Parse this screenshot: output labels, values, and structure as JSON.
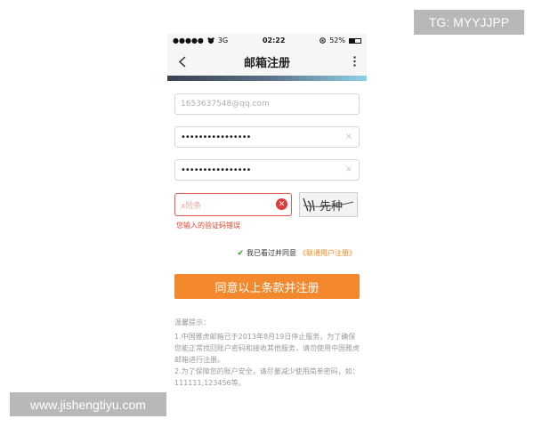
{
  "watermarks": {
    "top_right": "TG: MYYJJPP",
    "bottom_left": "www.jishengtiyu.com"
  },
  "status_bar": {
    "signal": "●●●●●",
    "carrier_icon": "bear-logo-icon",
    "network": "3G",
    "time": "02:22",
    "battery_percent": "52%",
    "battery_level": 0.52
  },
  "nav": {
    "title": "邮箱注册",
    "back_icon": "chevron-left-icon",
    "more_icon": "more-vertical-icon"
  },
  "form": {
    "email_placeholder": "1653637548@qq.com",
    "password_value": "••••••••••••••••",
    "confirm_password_value": "••••••••••••••••",
    "clear_glyph": "×",
    "captcha_placeholder": "x险条",
    "captcha_image_text": "先种",
    "error_icon_glyph": "✕",
    "error_message": "您输入的验证码错误"
  },
  "agreement": {
    "check_glyph": "✔",
    "text": "我已看过并同意",
    "link": "《联通用户注册》"
  },
  "submit_label": "同意以上条款并注册",
  "tips": {
    "title": "温馨提示：",
    "line1": "1.中国雅虎邮箱已于2013年8月19日停止服务，为了确保您能正常找回账户密码和接收其他服务，请勿使用中国雅虎邮箱进行注册。",
    "line2": "2.为了保障您的账户安全，请尽量减少使用简单密码，如：111111,123456等。"
  },
  "colors": {
    "accent": "#f4882c",
    "error": "#e0442f",
    "check": "#2e9a2e"
  }
}
